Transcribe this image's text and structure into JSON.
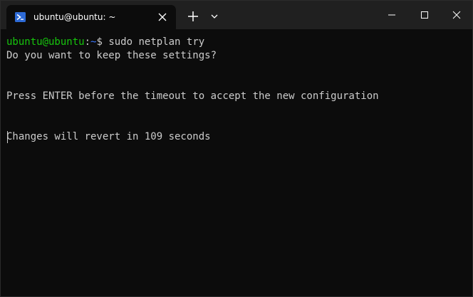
{
  "window": {
    "tab_title": "ubuntu@ubuntu: ~",
    "icons": {
      "tab": "powershell-prompt-icon",
      "tab_close": "close-icon",
      "new_tab": "plus-icon",
      "dropdown": "chevron-down-icon",
      "minimize": "minimize-icon",
      "maximize": "maximize-icon",
      "close": "close-icon"
    }
  },
  "terminal": {
    "prompt_user": "ubuntu@ubuntu",
    "prompt_sep": ":",
    "prompt_path": "~",
    "prompt_symbol": "$ ",
    "command": "sudo netplan try",
    "lines": [
      "Do you want to keep these settings?",
      "Press ENTER before the timeout to accept the new configuration",
      "Changes will revert in 109 seconds"
    ]
  },
  "colors": {
    "background": "#0c0c0c",
    "titlebar": "#202020",
    "text": "#cccccc",
    "prompt_user": "#16c60c",
    "prompt_path": "#3b78ff"
  }
}
